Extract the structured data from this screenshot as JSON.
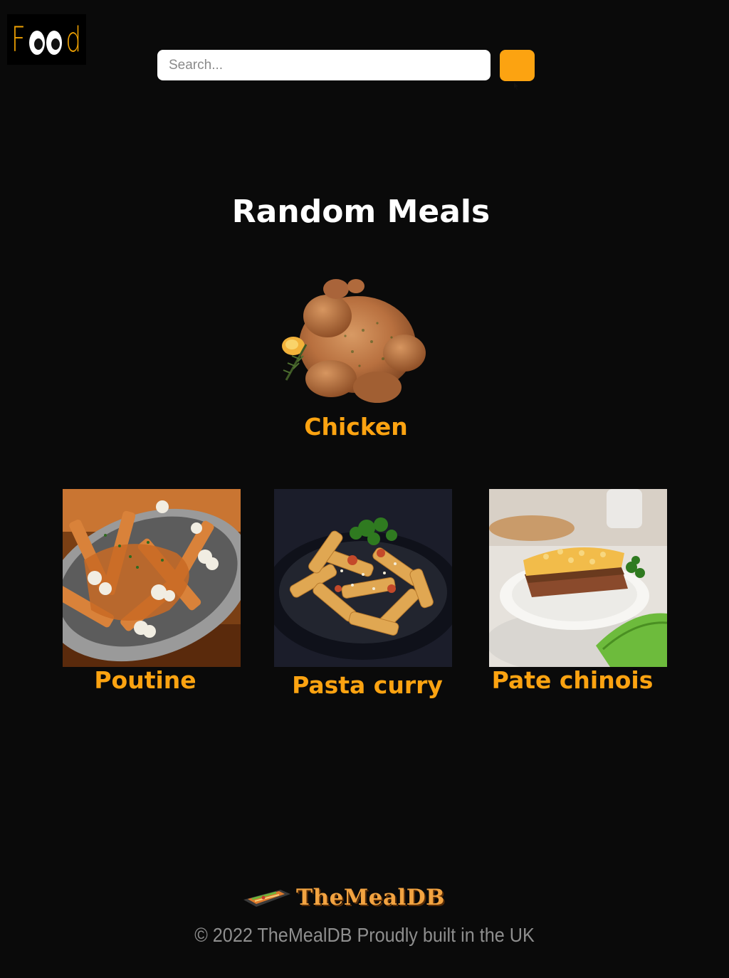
{
  "header": {
    "logo_letters": [
      "F",
      "d"
    ],
    "logo_alt": "Food",
    "search": {
      "placeholder": "Search...",
      "value": ""
    },
    "search_button_color": "#fca311"
  },
  "main": {
    "title": "Random Meals",
    "featured": {
      "label": "Chicken",
      "icon": "roast-chicken-image"
    },
    "meals": [
      {
        "label": "Poutine",
        "icon": "poutine-image"
      },
      {
        "label": "Pasta curry",
        "icon": "pasta-curry-image"
      },
      {
        "label": "Pate chinois",
        "icon": "pate-chinois-image"
      }
    ]
  },
  "footer": {
    "brand": "TheMealDB",
    "copyright": "© 2022 TheMealDB  Proudly built in the UK"
  },
  "colors": {
    "background": "#0a0a0a",
    "accent": "#fca311",
    "title": "#ffffff",
    "footer_text": "#8e8e8e"
  }
}
